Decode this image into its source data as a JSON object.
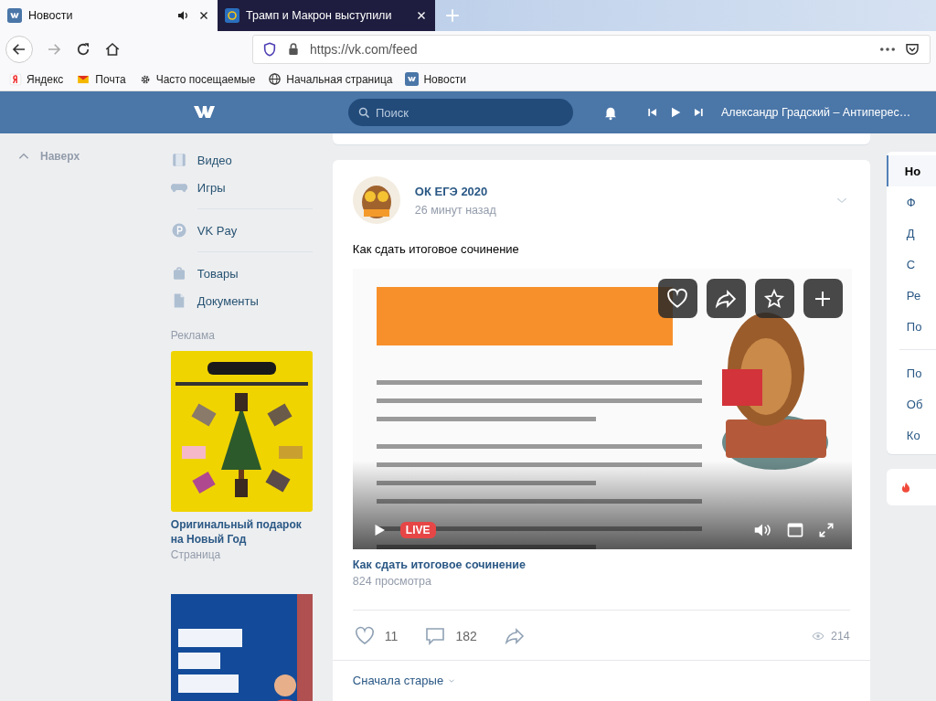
{
  "browser": {
    "tabs": [
      {
        "title": "Новости",
        "selected": true,
        "audio": true
      },
      {
        "title": "Трамп и Макрон выступили",
        "selected": false,
        "audio": false
      }
    ],
    "url": "https://vk.com/feed",
    "bookmarks": [
      "Яндекс",
      "Почта",
      "Часто посещаемые",
      "Начальная страница",
      "Новости"
    ]
  },
  "header": {
    "search": {
      "placeholder": "Поиск"
    },
    "track": "Александр Градский – Антиперес…"
  },
  "scroll_up": "Наверх",
  "menu": [
    [
      "Видео",
      "Игры"
    ],
    [
      "VK Pay"
    ],
    [
      "Товары",
      "Документы"
    ]
  ],
  "ads": {
    "label": "Реклама",
    "title": "Оригинальный подарок на Новый Год",
    "subtitle": "Страница"
  },
  "post": {
    "author": "ОК ЕГЭ 2020",
    "time": "26 минут назад",
    "text": "Как сдать итоговое сочинение",
    "video": {
      "badge": "LIVE",
      "title": "Как сдать итоговое сочинение",
      "views": "824 просмотра"
    },
    "likes": "11",
    "comments": "182",
    "views": "214",
    "sort": "Сначала старые"
  },
  "right_nav": [
    [
      {
        "label": "Но",
        "selected": true
      },
      {
        "label": "Ф",
        "selected": false
      },
      {
        "label": "Д",
        "selected": false
      },
      {
        "label": "С",
        "selected": false
      },
      {
        "label": "Ре",
        "selected": false
      },
      {
        "label": "По",
        "selected": false
      }
    ],
    [
      {
        "label": "По",
        "selected": false
      },
      {
        "label": "Об",
        "selected": false
      },
      {
        "label": "Ко",
        "selected": false
      }
    ]
  ]
}
